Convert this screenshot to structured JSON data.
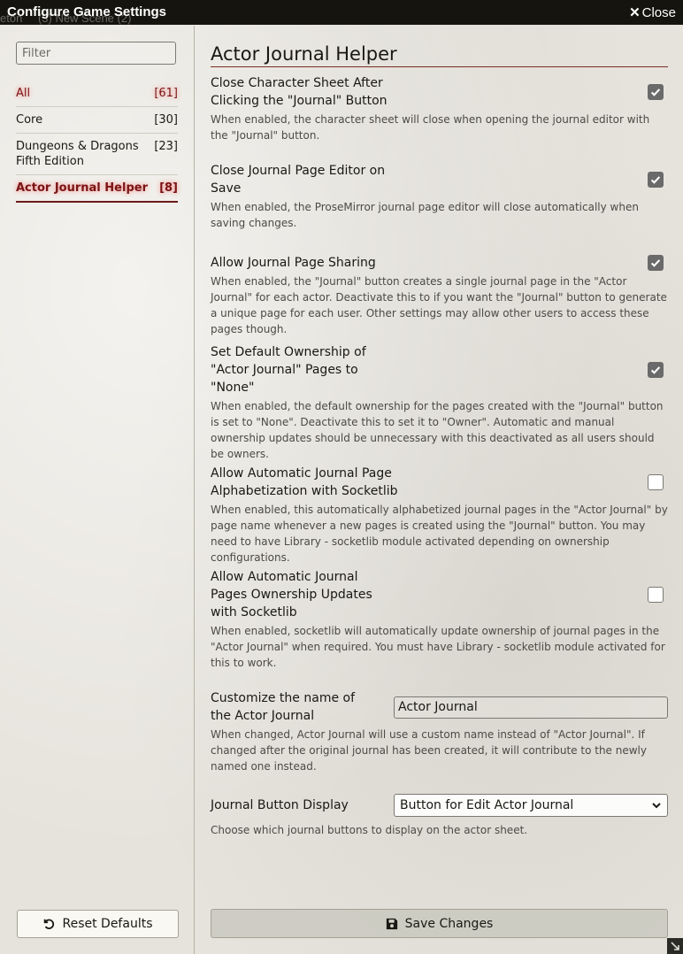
{
  "window": {
    "title": "Configure Game Settings",
    "close_label": "Close",
    "ghost_text": [
      "eton",
      "(3) New Scene (2)"
    ]
  },
  "sidebar": {
    "filter_placeholder": "Filter",
    "categories": [
      {
        "name": "All",
        "count": "[61]"
      },
      {
        "name": "Core",
        "count": "[30]"
      },
      {
        "name": "Dungeons & Dragons Fifth Edition",
        "count": "[23]"
      },
      {
        "name": "Actor Journal Helper",
        "count": "[8]"
      }
    ],
    "reset_label": "Reset Defaults"
  },
  "main": {
    "heading": "Actor Journal Helper",
    "settings": [
      {
        "label": "Close Character Sheet After Clicking the \"Journal\" Button",
        "hint": "When enabled, the character sheet will close when opening the journal editor with the \"Journal\" button.",
        "checked": true
      },
      {
        "label": "Close Journal Page Editor on Save",
        "hint": "When enabled, the ProseMirror journal page editor will close automatically when saving changes.",
        "checked": true
      },
      {
        "label": "Allow Journal Page Sharing",
        "hint": "When enabled, the \"Journal\" button creates a single journal page in the \"Actor Journal\" for each actor. Deactivate this to if you want the \"Journal\" button to generate a unique page for each user. Other settings may allow other users to access these pages though.",
        "checked": true
      },
      {
        "label": "Set Default Ownership of \"Actor Journal\" Pages to \"None\"",
        "hint": "When enabled, the default ownership for the pages created with the \"Journal\" button is set to \"None\". Deactivate this to set it to \"Owner\". Automatic and manual ownership updates should be unnecessary with this deactivated as all users should be owners.",
        "checked": true
      },
      {
        "label": "Allow Automatic Journal Page Alphabetization with Socketlib",
        "hint": "When enabled, this automatically alphabetized journal pages in the \"Actor Journal\" by page name whenever a new pages is created using the \"Journal\" button. You may need to have Library - socketlib module activated depending on ownership configurations.",
        "checked": false
      },
      {
        "label": "Allow Automatic Journal Pages Ownership Updates with Socketlib",
        "hint": "When enabled, socketlib will automatically update ownership of journal pages in the \"Actor Journal\" when required. You must have Library - socketlib module activated for this to work.",
        "checked": false
      }
    ],
    "name_setting": {
      "label": "Customize the name of the Actor Journal",
      "value": "Actor Journal",
      "hint": "When changed, Actor Journal will use a custom name instead of \"Actor Journal\". If changed after the original journal has been created, it will contribute to the newly named one instead."
    },
    "display_setting": {
      "label": "Journal Button Display",
      "selected": "Button for Edit Actor Journal",
      "hint": "Choose which journal buttons to display on the actor sheet."
    },
    "save_label": "Save Changes"
  }
}
